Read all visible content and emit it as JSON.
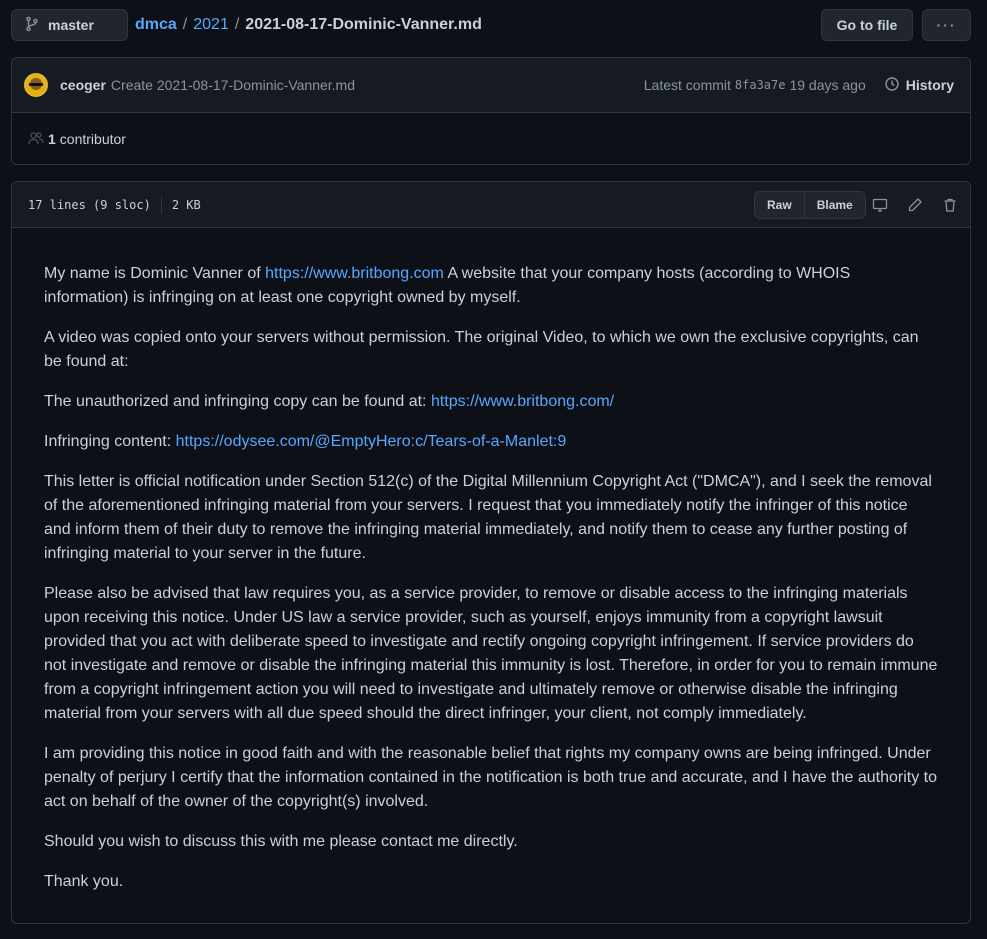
{
  "topbar": {
    "branch": "master",
    "repo": "dmca",
    "folder": "2021",
    "filename": "2021-08-17-Dominic-Vanner.md",
    "goto_label": "Go to file",
    "more_label": "···"
  },
  "commit": {
    "author": "ceoger",
    "message": "Create 2021-08-17-Dominic-Vanner.md",
    "latest_label": "Latest commit",
    "sha": "8fa3a7e",
    "time": "19 days ago",
    "history_label": "History",
    "contributors_count": "1",
    "contributors_label": "contributor"
  },
  "file": {
    "lines": "17 lines (9 sloc)",
    "size": "2 KB",
    "raw_label": "Raw",
    "blame_label": "Blame"
  },
  "content": {
    "p1_a": "My name is Dominic Vanner of ",
    "p1_link": "https://www.britbong.com",
    "p1_b": " A website that your company hosts (according to WHOIS information) is infringing on at least one copyright owned by myself.",
    "p2": "A video was copied onto your servers without permission. The original Video, to which we own the exclusive copyrights, can be found at:",
    "p3_a": "The unauthorized and infringing copy can be found at: ",
    "p3_link": "https://www.britbong.com/",
    "p4_a": "Infringing content: ",
    "p4_link": "https://odysee.com/@EmptyHero:c/Tears-of-a-Manlet:9",
    "p5": "This letter is official notification under Section 512(c) of the Digital Millennium Copyright Act (\"DMCA\"), and I seek the removal of the aforementioned infringing material from your servers. I request that you immediately notify the infringer of this notice and inform them of their duty to remove the infringing material immediately, and notify them to cease any further posting of infringing material to your server in the future.",
    "p6": "Please also be advised that law requires you, as a service provider, to remove or disable access to the infringing materials upon receiving this notice. Under US law a service provider, such as yourself, enjoys immunity from a copyright lawsuit provided that you act with deliberate speed to investigate and rectify ongoing copyright infringement. If service providers do not investigate and remove or disable the infringing material this immunity is lost. Therefore, in order for you to remain immune from a copyright infringement action you will need to investigate and ultimately remove or otherwise disable the infringing material from your servers with all due speed should the direct infringer, your client, not comply immediately.",
    "p7": "I am providing this notice in good faith and with the reasonable belief that rights my company owns are being infringed. Under penalty of perjury I certify that the information contained in the notification is both true and accurate, and I have the authority to act on behalf of the owner of the copyright(s) involved.",
    "p8": "Should you wish to discuss this with me please contact me directly.",
    "p9": "Thank you."
  }
}
